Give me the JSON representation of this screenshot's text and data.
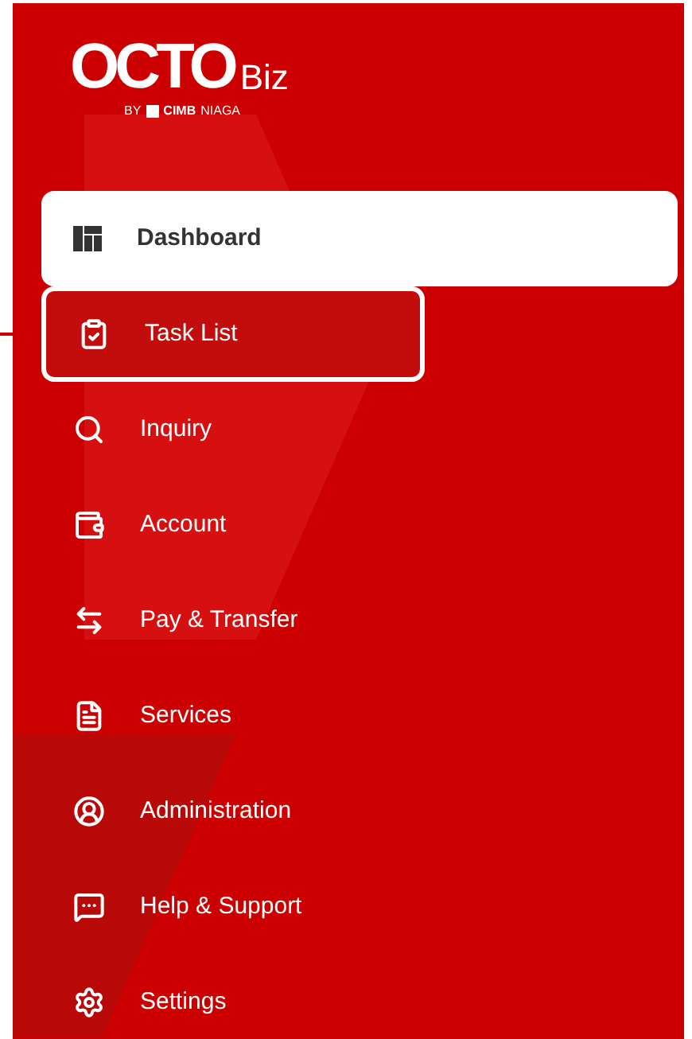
{
  "logo": {
    "wordmark": "OCTO",
    "suffix": "Biz",
    "byline_prefix": "BY",
    "byline_brand": "CIMB",
    "byline_suffix": "NIAGA"
  },
  "menu": [
    {
      "label": "Dashboard",
      "kind": "dashboard",
      "selected": true,
      "highlighted": false
    },
    {
      "label": "Task List",
      "kind": "tasks",
      "selected": false,
      "highlighted": true
    },
    {
      "label": "Inquiry",
      "kind": "search",
      "selected": false,
      "highlighted": false
    },
    {
      "label": "Account",
      "kind": "wallet",
      "selected": false,
      "highlighted": false
    },
    {
      "label": "Pay & Transfer",
      "kind": "transfer",
      "selected": false,
      "highlighted": false
    },
    {
      "label": "Services",
      "kind": "document",
      "selected": false,
      "highlighted": false
    },
    {
      "label": "Administration",
      "kind": "user",
      "selected": false,
      "highlighted": false
    },
    {
      "label": "Help & Support",
      "kind": "help",
      "selected": false,
      "highlighted": false
    },
    {
      "label": "Settings",
      "kind": "settings",
      "selected": false,
      "highlighted": false
    }
  ]
}
